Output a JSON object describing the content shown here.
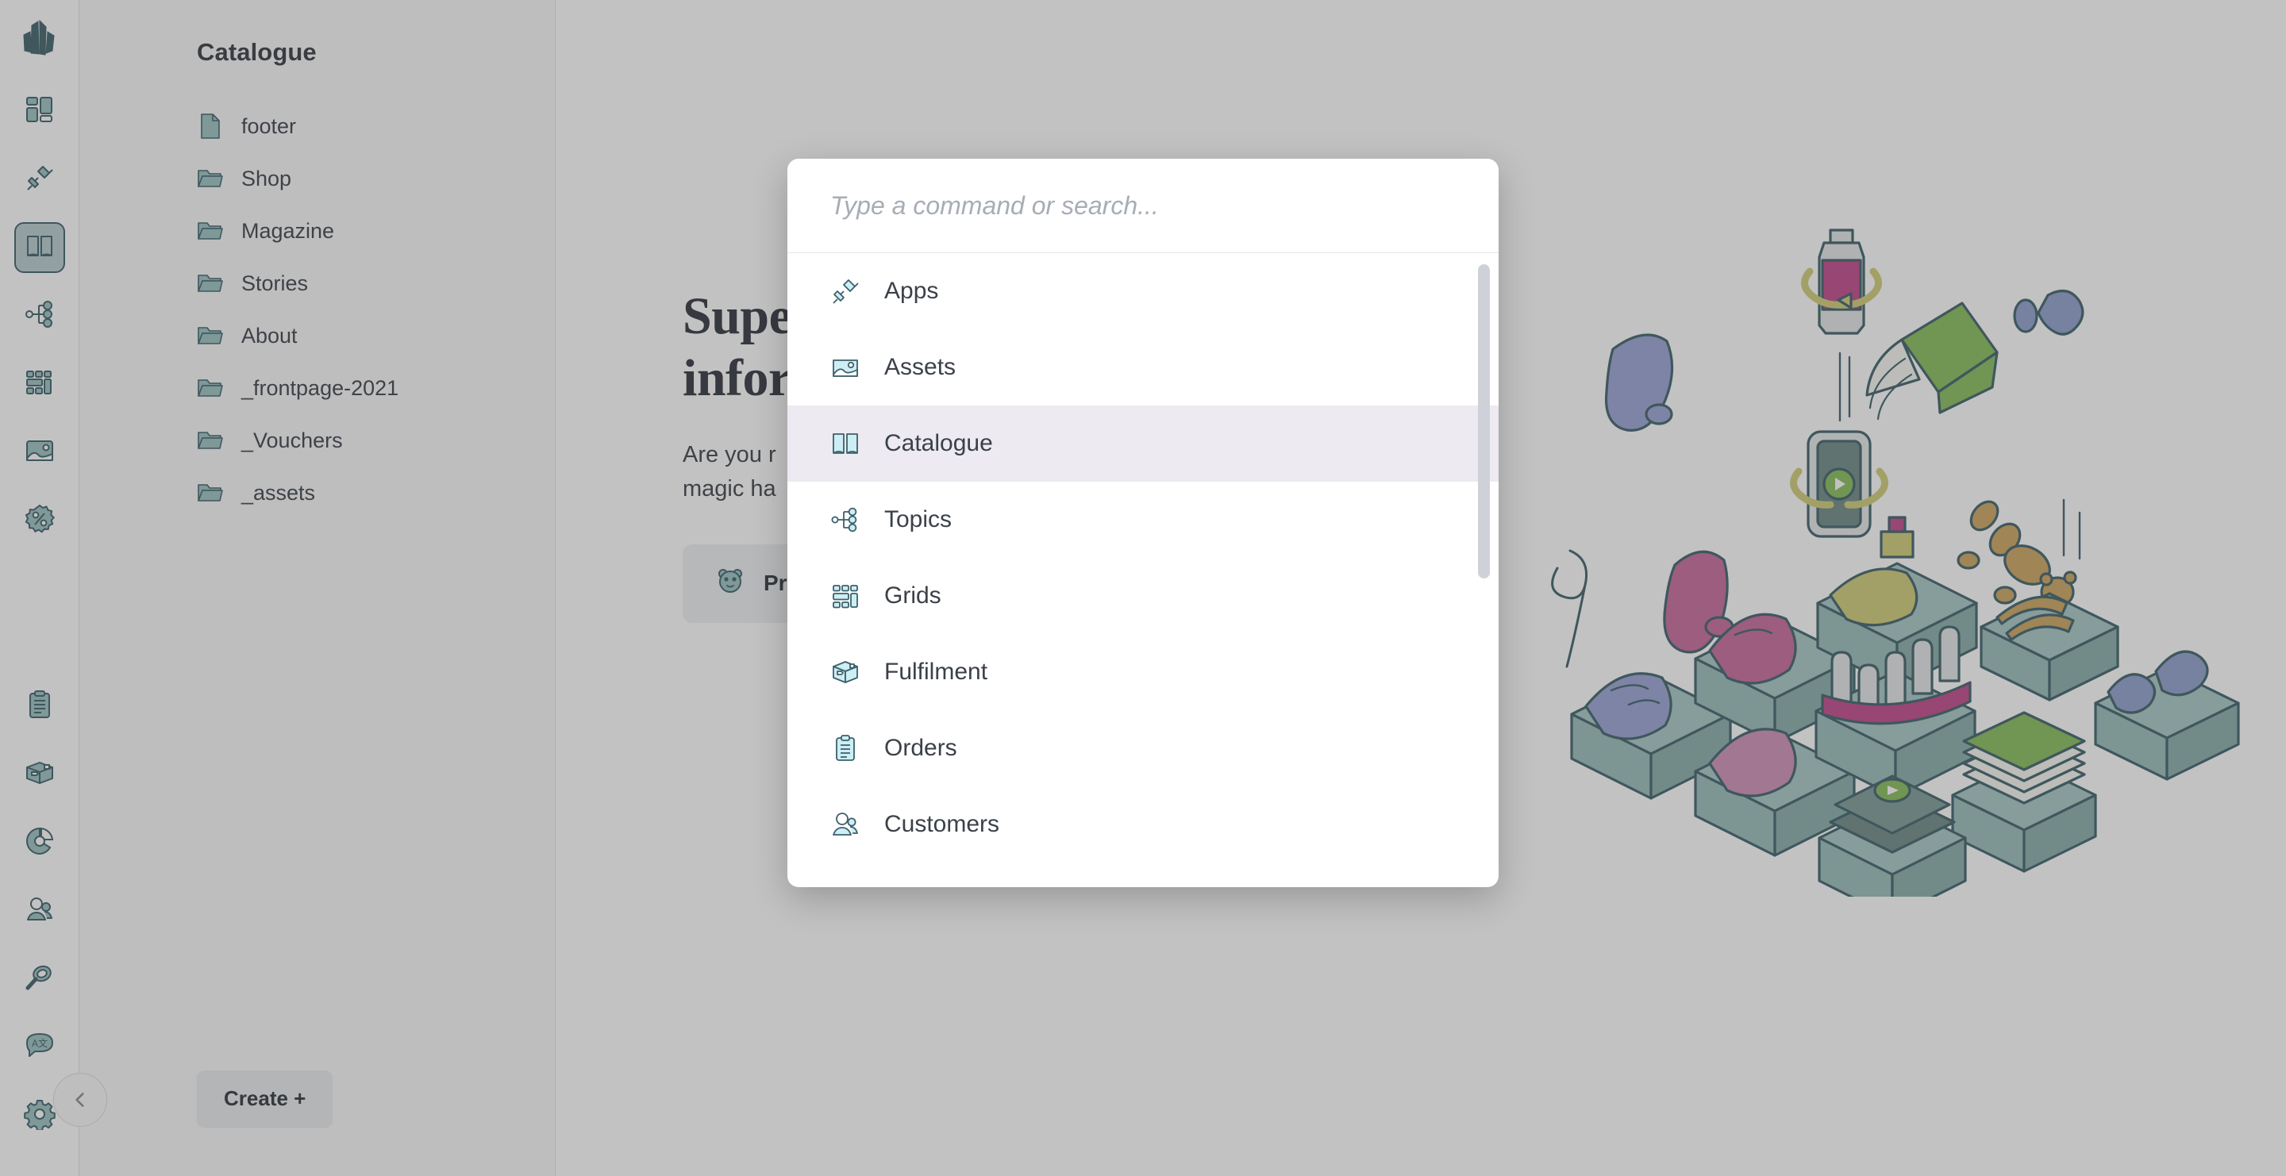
{
  "colors": {
    "accent_teal": "#3d6069",
    "icon_fill_sidebar": "#9bc0c1",
    "icon_fill_palette": "#cdeef5",
    "selected_row_bg": "#edeaf1",
    "scrim": "rgba(70,70,70,.33)",
    "text": "#3b4149"
  },
  "rail": {
    "logo_icon": "crystal-logo-icon",
    "items": [
      {
        "icon": "blocks-icon",
        "name": "blocks"
      },
      {
        "icon": "plug-apps-icon",
        "name": "apps"
      },
      {
        "icon": "book-catalogue-icon",
        "name": "catalogue",
        "active": true
      },
      {
        "icon": "topics-tree-icon",
        "name": "topics"
      },
      {
        "icon": "grids-icon",
        "name": "grids"
      },
      {
        "icon": "image-assets-icon",
        "name": "assets"
      },
      {
        "icon": "discount-badge-icon",
        "name": "vouchers"
      }
    ],
    "bottom_items": [
      {
        "icon": "clipboard-orders-icon",
        "name": "orders"
      },
      {
        "icon": "box-fulfilment-icon",
        "name": "fulfilment"
      },
      {
        "icon": "donut-chart-icon",
        "name": "analytics"
      },
      {
        "icon": "customers-icon",
        "name": "customers"
      },
      {
        "icon": "magnifier-search-icon",
        "name": "search"
      },
      {
        "icon": "translate-icon",
        "name": "language"
      },
      {
        "icon": "gear-settings-icon",
        "name": "settings"
      }
    ]
  },
  "sidebar": {
    "title": "Catalogue",
    "tree": [
      {
        "label": "footer",
        "type": "file"
      },
      {
        "label": "Shop",
        "type": "folder"
      },
      {
        "label": "Magazine",
        "type": "folder"
      },
      {
        "label": "Stories",
        "type": "folder"
      },
      {
        "label": "About",
        "type": "folder"
      },
      {
        "label": "_frontpage-2021",
        "type": "folder"
      },
      {
        "label": "_Vouchers",
        "type": "folder"
      },
      {
        "label": "_assets",
        "type": "folder"
      }
    ],
    "create_label": "Create +",
    "collapse_icon": "chevron-left-icon"
  },
  "main": {
    "heading_line1": "Super",
    "heading_line2": "infor",
    "body_line1": "Are you r",
    "body_line2": "magic ha",
    "cta_label": "Pr",
    "cta_icon": "bear-mascot-icon",
    "illustration": "isometric-product-boxes-illustration"
  },
  "palette": {
    "placeholder": "Type a command or search...",
    "value": "",
    "items": [
      {
        "label": "Apps",
        "icon": "plug-apps-icon"
      },
      {
        "label": "Assets",
        "icon": "image-assets-icon"
      },
      {
        "label": "Catalogue",
        "icon": "book-catalogue-icon",
        "selected": true
      },
      {
        "label": "Topics",
        "icon": "topics-tree-icon"
      },
      {
        "label": "Grids",
        "icon": "grids-icon"
      },
      {
        "label": "Fulfilment",
        "icon": "box-fulfilment-icon"
      },
      {
        "label": "Orders",
        "icon": "clipboard-orders-icon"
      },
      {
        "label": "Customers",
        "icon": "customers-icon"
      }
    ],
    "scrollbar": "vertical-scrollbar"
  }
}
